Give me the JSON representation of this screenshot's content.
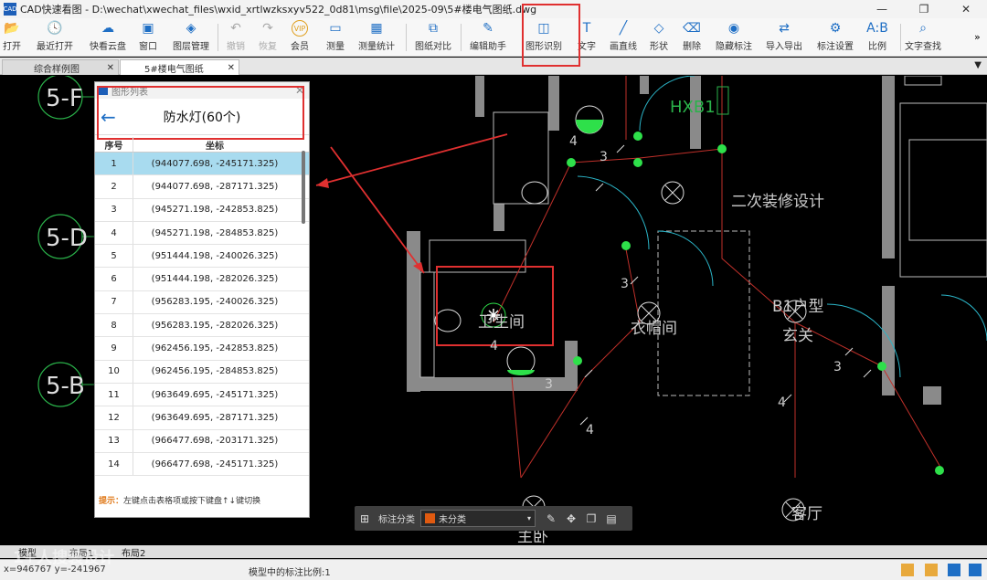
{
  "window": {
    "title": "CAD快速看图 - D:\\wechat\\xwechat_files\\wxid_xrtlwzksxyv522_0d81\\msg\\file\\2025-09\\5#楼电气图纸.dwg",
    "logo": "CAD"
  },
  "toolbar": {
    "items": [
      {
        "label": "打开",
        "icon": "folder-icon",
        "glyph": "📂"
      },
      {
        "label": "最近打开",
        "icon": "clock-icon",
        "glyph": "🕓"
      },
      {
        "label": "快看云盘",
        "icon": "cloud-icon",
        "glyph": "☁"
      },
      {
        "label": "窗口",
        "icon": "window-icon",
        "glyph": "▣"
      },
      {
        "label": "图层管理",
        "icon": "layers-icon",
        "glyph": "◈"
      },
      {
        "label": "撤销",
        "icon": "undo-icon",
        "glyph": "↶"
      },
      {
        "label": "恢复",
        "icon": "redo-icon",
        "glyph": "↷"
      },
      {
        "label": "会员",
        "icon": "vip-icon",
        "glyph": "VIP"
      },
      {
        "label": "测量",
        "icon": "ruler-icon",
        "glyph": "▭"
      },
      {
        "label": "测量统计",
        "icon": "measure-stats-icon",
        "glyph": "▦"
      },
      {
        "label": "图纸对比",
        "icon": "compare-icon",
        "glyph": "⧉"
      },
      {
        "label": "编辑助手",
        "icon": "edit-helper-icon",
        "glyph": "✎"
      },
      {
        "label": "图形识别",
        "icon": "shape-recognition-icon",
        "glyph": "◫"
      },
      {
        "label": "文字",
        "icon": "text-icon",
        "glyph": "T"
      },
      {
        "label": "画直线",
        "icon": "line-icon",
        "glyph": "╱"
      },
      {
        "label": "形状",
        "icon": "shape-icon",
        "glyph": "◇"
      },
      {
        "label": "删除",
        "icon": "eraser-icon",
        "glyph": "⌫"
      },
      {
        "label": "隐藏标注",
        "icon": "eye-hide-icon",
        "glyph": "◉"
      },
      {
        "label": "导入导出",
        "icon": "import-export-icon",
        "glyph": "⇄"
      },
      {
        "label": "标注设置",
        "icon": "annotation-settings-icon",
        "glyph": "⚙"
      },
      {
        "label": "比例",
        "icon": "scale-icon",
        "glyph": "A:B"
      },
      {
        "label": "文字查找",
        "icon": "text-search-icon",
        "glyph": "⌕"
      }
    ],
    "more": "»"
  },
  "tabs": [
    {
      "label": "综合样例图",
      "close": "✕"
    },
    {
      "label": "5#楼电气图纸",
      "close": "✕"
    }
  ],
  "tabs_menu": "▼",
  "panel": {
    "header": "图形列表",
    "close": "✕",
    "back": "←",
    "title": "防水灯(60个)",
    "columns": [
      "序号",
      "坐标"
    ],
    "rows": [
      [
        "1",
        "(944077.698, -245171.325)"
      ],
      [
        "2",
        "(944077.698, -287171.325)"
      ],
      [
        "3",
        "(945271.198, -242853.825)"
      ],
      [
        "4",
        "(945271.198, -284853.825)"
      ],
      [
        "5",
        "(951444.198, -240026.325)"
      ],
      [
        "6",
        "(951444.198, -282026.325)"
      ],
      [
        "7",
        "(956283.195, -240026.325)"
      ],
      [
        "8",
        "(956283.195, -282026.325)"
      ],
      [
        "9",
        "(962456.195, -242853.825)"
      ],
      [
        "10",
        "(962456.195, -284853.825)"
      ],
      [
        "11",
        "(963649.695, -245171.325)"
      ],
      [
        "12",
        "(963649.695, -287171.325)"
      ],
      [
        "13",
        "(966477.698, -203171.325)"
      ],
      [
        "14",
        "(966477.698, -245171.325)"
      ]
    ],
    "hint_key": "提示：",
    "hint_text": "左键点击表格项或按下键盘↑↓键切换"
  },
  "cad": {
    "labels": [
      "5-F",
      "5-D",
      "5-B",
      "HXB1",
      "二次装修设计",
      "卫生间",
      "衣帽间",
      "B1户型",
      "玄关",
      "客厅",
      "主卧",
      "4",
      "3",
      "4",
      "3",
      "3",
      "4",
      "3",
      "4"
    ]
  },
  "float_bar": {
    "label": "标注分类",
    "category": "未分类",
    "arrow": "▾"
  },
  "layout_tabs": [
    "模型",
    "布局1",
    "布局2"
  ],
  "status": {
    "coord": "x=946767  y=-241967",
    "scale": "模型中的标注比例:1"
  },
  "watermark": "1+人搜装设计"
}
